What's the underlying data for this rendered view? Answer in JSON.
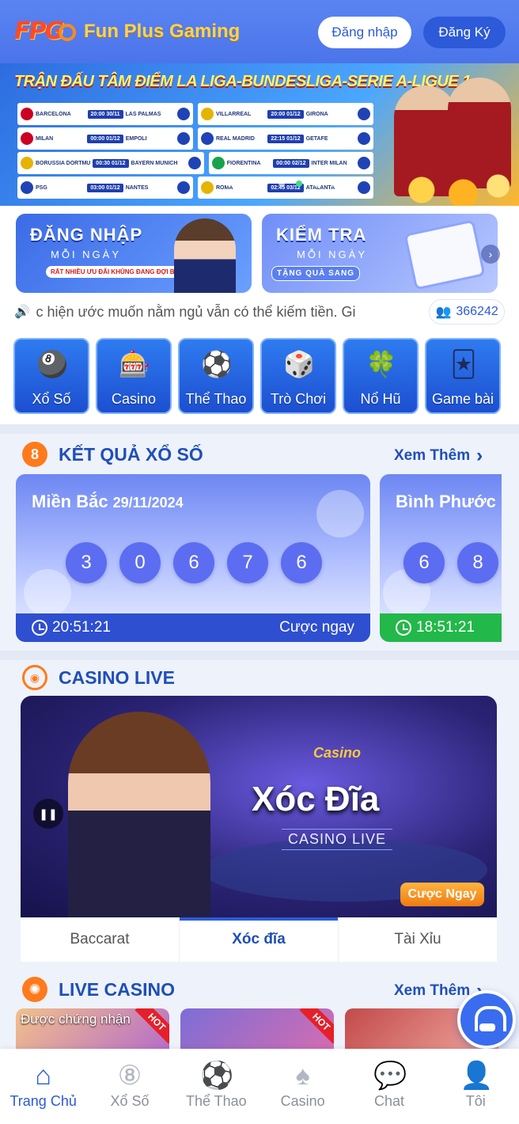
{
  "header": {
    "logo_text": "FPG",
    "brand": "Fun Plus Gaming",
    "login_label": "Đăng nhập",
    "register_label": "Đăng Ký"
  },
  "hero": {
    "title": "TRẬN ĐẤU TÂM ĐIỂM LA LIGA-BUNDESLIGA-SERIE A-LIGUE 1",
    "matches": [
      [
        {
          "home": "BARCELONA",
          "time": "20:00 30/11",
          "away": "LAS PALMAS"
        },
        {
          "home": "VILLARREAL",
          "time": "20:00 01/12",
          "away": "GIRONA"
        }
      ],
      [
        {
          "home": "MILAN",
          "time": "00:00 01/12",
          "away": "EMPOLI"
        },
        {
          "home": "REAL MADRID",
          "time": "22:15 01/12",
          "away": "GETAFE"
        }
      ],
      [
        {
          "home": "BORUSSIA DORTMUND",
          "time": "00:30 01/12",
          "away": "BAYERN MUNICH"
        },
        {
          "home": "FIORENTINA",
          "time": "00:00 02/12",
          "away": "INTER MILAN"
        }
      ],
      [
        {
          "home": "PSG",
          "time": "03:00 01/12",
          "away": "NANTES"
        },
        {
          "home": "ROMA",
          "time": "02:45 03/12",
          "away": "ATALANTA"
        }
      ]
    ],
    "slide_count": 7,
    "active_slide": 4
  },
  "promos": [
    {
      "title": "ĐĂNG NHẬP",
      "sub": "MỖI NGÀY",
      "tag": "RẤT NHIỀU ƯU ĐÃI KHỦNG ĐANG ĐỢI BẠN"
    },
    {
      "title": "KIỂM TRA",
      "sub": "MỖI NGÀY",
      "tag": "TẶNG QUÀ SANG"
    }
  ],
  "marquee": {
    "text": "c hiện ước muốn nằm ngủ vẫn có thể kiếm tiền. Gi",
    "online_count": "366242"
  },
  "categories": [
    {
      "label": "Xổ Số",
      "icon": "lottery-balls-icon",
      "glyph": "🎱"
    },
    {
      "label": "Casino",
      "icon": "roulette-icon",
      "glyph": "🎰"
    },
    {
      "label": "Thể Thao",
      "icon": "soccer-ball-icon",
      "glyph": "⚽"
    },
    {
      "label": "Trò Chơi",
      "icon": "dice-icon",
      "glyph": "🎲"
    },
    {
      "label": "Nổ Hũ",
      "icon": "slot-jackpot-icon",
      "glyph": "🍀"
    },
    {
      "label": "Game bài",
      "icon": "playing-cards-icon",
      "glyph": "🃏"
    }
  ],
  "lottery": {
    "section_title": "KẾT QUẢ XỔ SỐ",
    "see_more": "Xem Thêm",
    "cards": [
      {
        "region": "Miền Bắc",
        "date": "29/11/2024",
        "numbers": [
          "3",
          "0",
          "6",
          "7",
          "6"
        ],
        "time": "20:51:21",
        "action": "Cược ngay"
      },
      {
        "region": "Bình Phước",
        "numbers": [
          "6",
          "8"
        ],
        "time": "18:51:21"
      }
    ]
  },
  "casino_live": {
    "section_title": "CASINO LIVE",
    "banner_brand": "Casino",
    "banner_title": "Xóc Đĩa",
    "banner_sub": "CASINO LIVE",
    "bet_label": "Cược Ngay",
    "tabs": [
      "Baccarat",
      "Xóc đĩa",
      "Tài Xỉu"
    ],
    "active_tab": 1
  },
  "live_casino": {
    "section_title": "LIVE CASINO",
    "see_more": "Xem Thêm",
    "card_note": "Được chứng nhận",
    "hot_label": "HOT"
  },
  "bottom_nav": {
    "items": [
      {
        "label": "Trang Chủ",
        "icon": "home-icon",
        "glyph": "⌂"
      },
      {
        "label": "Xổ Số",
        "icon": "lottery-ball-icon",
        "glyph": "⑧"
      },
      {
        "label": "Thể Thao",
        "icon": "soccer-icon",
        "glyph": "⚽"
      },
      {
        "label": "Casino",
        "icon": "spade-icon",
        "glyph": "♠"
      },
      {
        "label": "Chat",
        "icon": "chat-icon",
        "glyph": "💬"
      },
      {
        "label": "Tôi",
        "icon": "user-icon",
        "glyph": "👤"
      }
    ],
    "active": 0
  },
  "colors": {
    "primary": "#2c5ad8",
    "accent": "#ff7a1a",
    "success": "#22b84a"
  }
}
